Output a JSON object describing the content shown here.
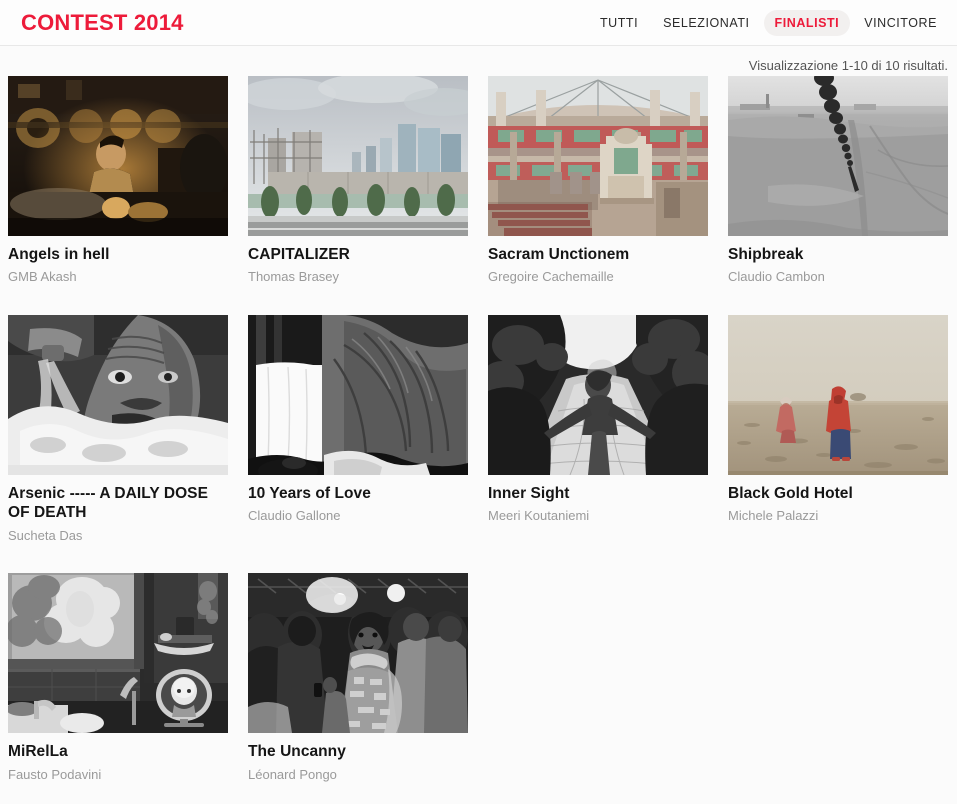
{
  "header": {
    "brand": "CONTEST 2014",
    "nav": [
      {
        "label": "TUTTI",
        "active": false
      },
      {
        "label": "SELEZIONATI",
        "active": false
      },
      {
        "label": "FINALISTI",
        "active": true
      },
      {
        "label": "VINCITORE",
        "active": false
      }
    ]
  },
  "results": {
    "count_text": "Visualizzazione 1-10 di 10 risultati."
  },
  "colors": {
    "brand_red": "#ed1b3a",
    "active_pill_bg": "#f2f0ef",
    "page_bg": "#fbfbfb",
    "title_text": "#151515",
    "author_text": "#9a9a9a"
  },
  "gallery": {
    "items": [
      {
        "title": "Angels in hell",
        "author": "GMB Akash",
        "thumb_name": "thumb-angels-in-hell",
        "scene": "boy working at lathe machinery in a dark workshop, warm golden tones"
      },
      {
        "title": "CAPITALIZER",
        "author": "Thomas Brasey",
        "thumb_name": "thumb-capitalizer",
        "scene": "glass skyscrapers behind a concrete wall and row of trees under a cloudy sky"
      },
      {
        "title": "Sacram Unctionem",
        "author": "Gregoire Cachemaille",
        "thumb_name": "thumb-sacram-unctionem",
        "scene": "derelict church interior with pink-red balconies, green panels and an altar"
      },
      {
        "title": "Shipbreak",
        "author": "Claudio Cambon",
        "thumb_name": "thumb-shipbreak",
        "scene": "black and white shipbreaking yard, heavy chain hanging over grey mudflats"
      },
      {
        "title": "Arsenic ----- A DAILY DOSE OF DEATH",
        "author": "Sucheta Das",
        "thumb_name": "thumb-arsenic-a-daily-dose-of-death",
        "scene": "black and white close-up of a man drinking from a gushing water pump"
      },
      {
        "title": "10 Years of Love",
        "author": "Claudio Gallone",
        "thumb_name": "thumb-10-years-of-love",
        "scene": "high contrast black and white draped fabric and white sheet"
      },
      {
        "title": "Inner Sight",
        "author": "Meeri Koutaniemi",
        "thumb_name": "thumb-inner-sight",
        "scene": "girl with outstretched arms on a cobbled path between dark hedges"
      },
      {
        "title": "Black Gold Hotel",
        "author": "Michele Palazzi",
        "thumb_name": "thumb-black-gold-hotel",
        "scene": "two figures in red clothing on a dusty desert plain under a hazy sky"
      },
      {
        "title": "MiRelLa",
        "author": "Fausto Podavini",
        "thumb_name": "thumb-mirella",
        "scene": "black and white bathroom, steamed window and a face in a round mirror"
      },
      {
        "title": "The Uncanny",
        "author": "Léonard Pongo",
        "thumb_name": "thumb-the-uncanny",
        "scene": "dark black and white nightclub crowd with a woman in a patterned dress"
      }
    ]
  }
}
